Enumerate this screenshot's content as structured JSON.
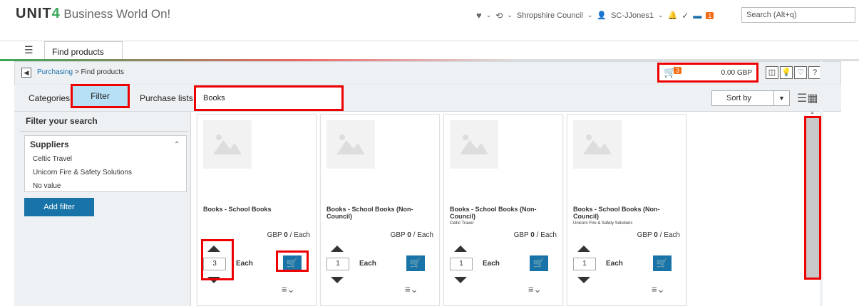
{
  "app": {
    "logo_unit": "UNIT",
    "logo_four": "4",
    "logo_name": "Business World On!"
  },
  "topbar": {
    "company": "Shropshire Council",
    "user": "SC-JJones1",
    "notif_count": "1",
    "search_placeholder": "Search (Alt+q)"
  },
  "tabs": [
    {
      "label": "Find products",
      "close": "x"
    }
  ],
  "breadcrumb": {
    "parent": "Purchasing",
    "sep": ">",
    "current": "Find products"
  },
  "cart": {
    "count": "3",
    "amount": "0.00 GBP"
  },
  "toolbar": {
    "categories": "Categories",
    "filter": "Filter",
    "purchase_lists": "Purchase lists",
    "search_value": "Books",
    "sort_label": "Sort by"
  },
  "filter_panel": {
    "heading": "Filter your search",
    "suppliers_heading": "Suppliers",
    "suppliers": [
      "Celtic Travel",
      "Unicorn Fire & Safety Solutions",
      "No value"
    ],
    "add_filter": "Add filter"
  },
  "products": [
    {
      "title": "Books - School Books",
      "subtitle": "",
      "price_prefix": "GBP",
      "price": "0",
      "price_unit": "/ Each",
      "qty": "3",
      "unit": "Each"
    },
    {
      "title": "Books - School Books (Non-Council)",
      "subtitle": "",
      "price_prefix": "GBP",
      "price": "0",
      "price_unit": "/ Each",
      "qty": "1",
      "unit": "Each"
    },
    {
      "title": "Books - School Books (Non-Council)",
      "subtitle": "Celtic Travel",
      "price_prefix": "GBP",
      "price": "0",
      "price_unit": "/ Each",
      "qty": "1",
      "unit": "Each"
    },
    {
      "title": "Books - School Books (Non-Council)",
      "subtitle": "Unicorn Fire & Safety Solutions",
      "price_prefix": "GBP",
      "price": "0",
      "price_unit": "/ Each",
      "qty": "1",
      "unit": "Each"
    }
  ],
  "colors": {
    "brand_green": "#3aa757",
    "link_blue": "#1a6ea8",
    "button_blue": "#1874a8",
    "badge_orange": "#f26a12",
    "highlight_red": "#e00"
  }
}
